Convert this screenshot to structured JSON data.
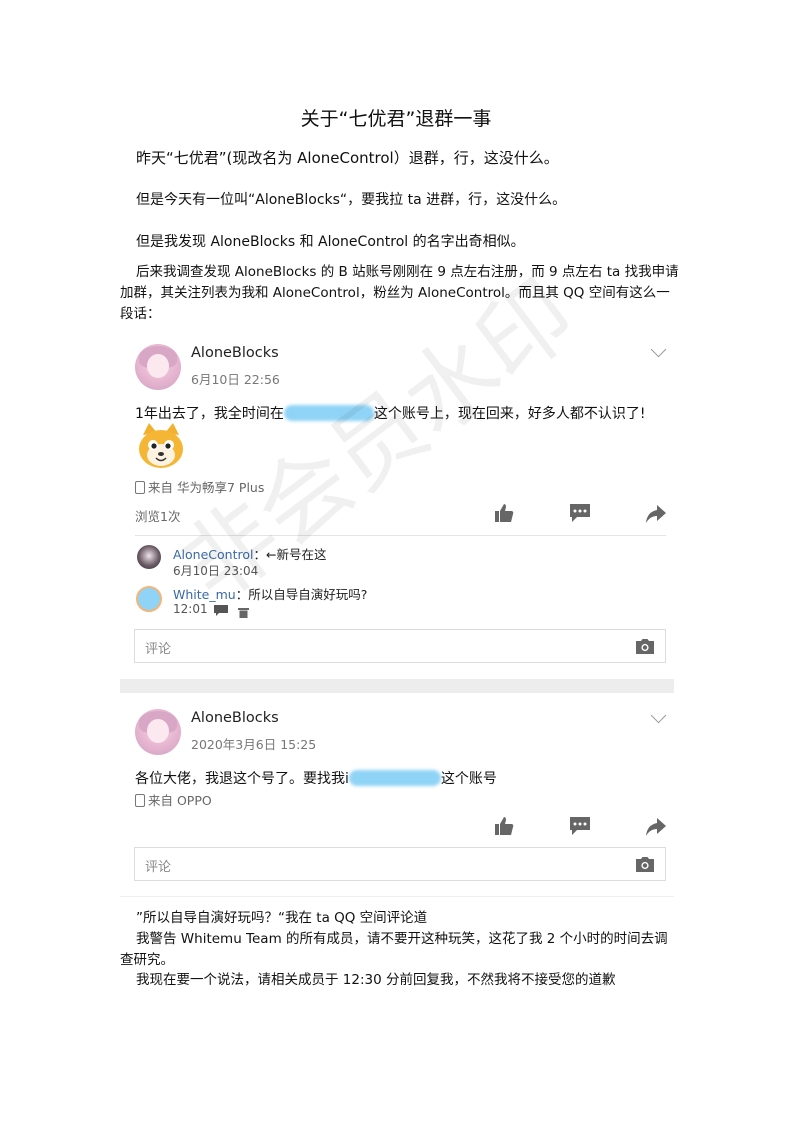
{
  "title": "关于“七优君”退群一事",
  "paragraphs": {
    "p1": "昨天“七优君”(现改名为 AloneControl）退群，行，这没什么。",
    "p2": "但是今天有一位叫“AloneBlocks“，要我拉 ta 进群，行，这没什么。",
    "p3": "但是我发现 AloneBlocks 和 AloneControl 的名字出奇相似。",
    "p4": "后来我调查发现 AloneBlocks 的 B 站账号刚刚在 9 点左右注册，而 9 点左右 ta 找我申请加群，其关注列表为我和 AloneControl，粉丝为 AloneControl。而且其 QQ 空间有这么一段话："
  },
  "post1": {
    "username": "AloneBlocks",
    "time": "6月10日 22:56",
    "text_before": "1年出去了，我全时间在",
    "text_after": "这个账号上，现在回来，好多人都不认识了!",
    "device": "来自 华为畅享7 Plus",
    "views": "浏览1次",
    "comments": [
      {
        "name": "AloneControl",
        "text": "：←新号在这",
        "time": "6月10日 23:04"
      },
      {
        "name": "White_mu",
        "text": "：所以自导自演好玩吗?",
        "time": "12:01"
      }
    ],
    "comment_placeholder": "评论"
  },
  "post2": {
    "username": "AloneBlocks",
    "time": "2020年3月6日 15:25",
    "text_before": "各位大佬，我退这个号了。要找我i",
    "text_after": "这个账号",
    "device": "来自 OPPO",
    "comment_placeholder": "评论"
  },
  "footer": {
    "l1": "”所以自导自演好玩吗？“我在 ta QQ 空间评论道",
    "l2": "我警告 Whitemu Team 的所有成员，请不要开这种玩笑，这花了我 2 个小时的时间去调查研究。",
    "l3": "我现在要一个说法，请相关成员于 12:30 分前回复我，不然我将不接受您的道歉"
  },
  "watermark": "非会员水印",
  "colors": {
    "link": "#3a6aa8",
    "redaction": "#8fd3f6"
  }
}
